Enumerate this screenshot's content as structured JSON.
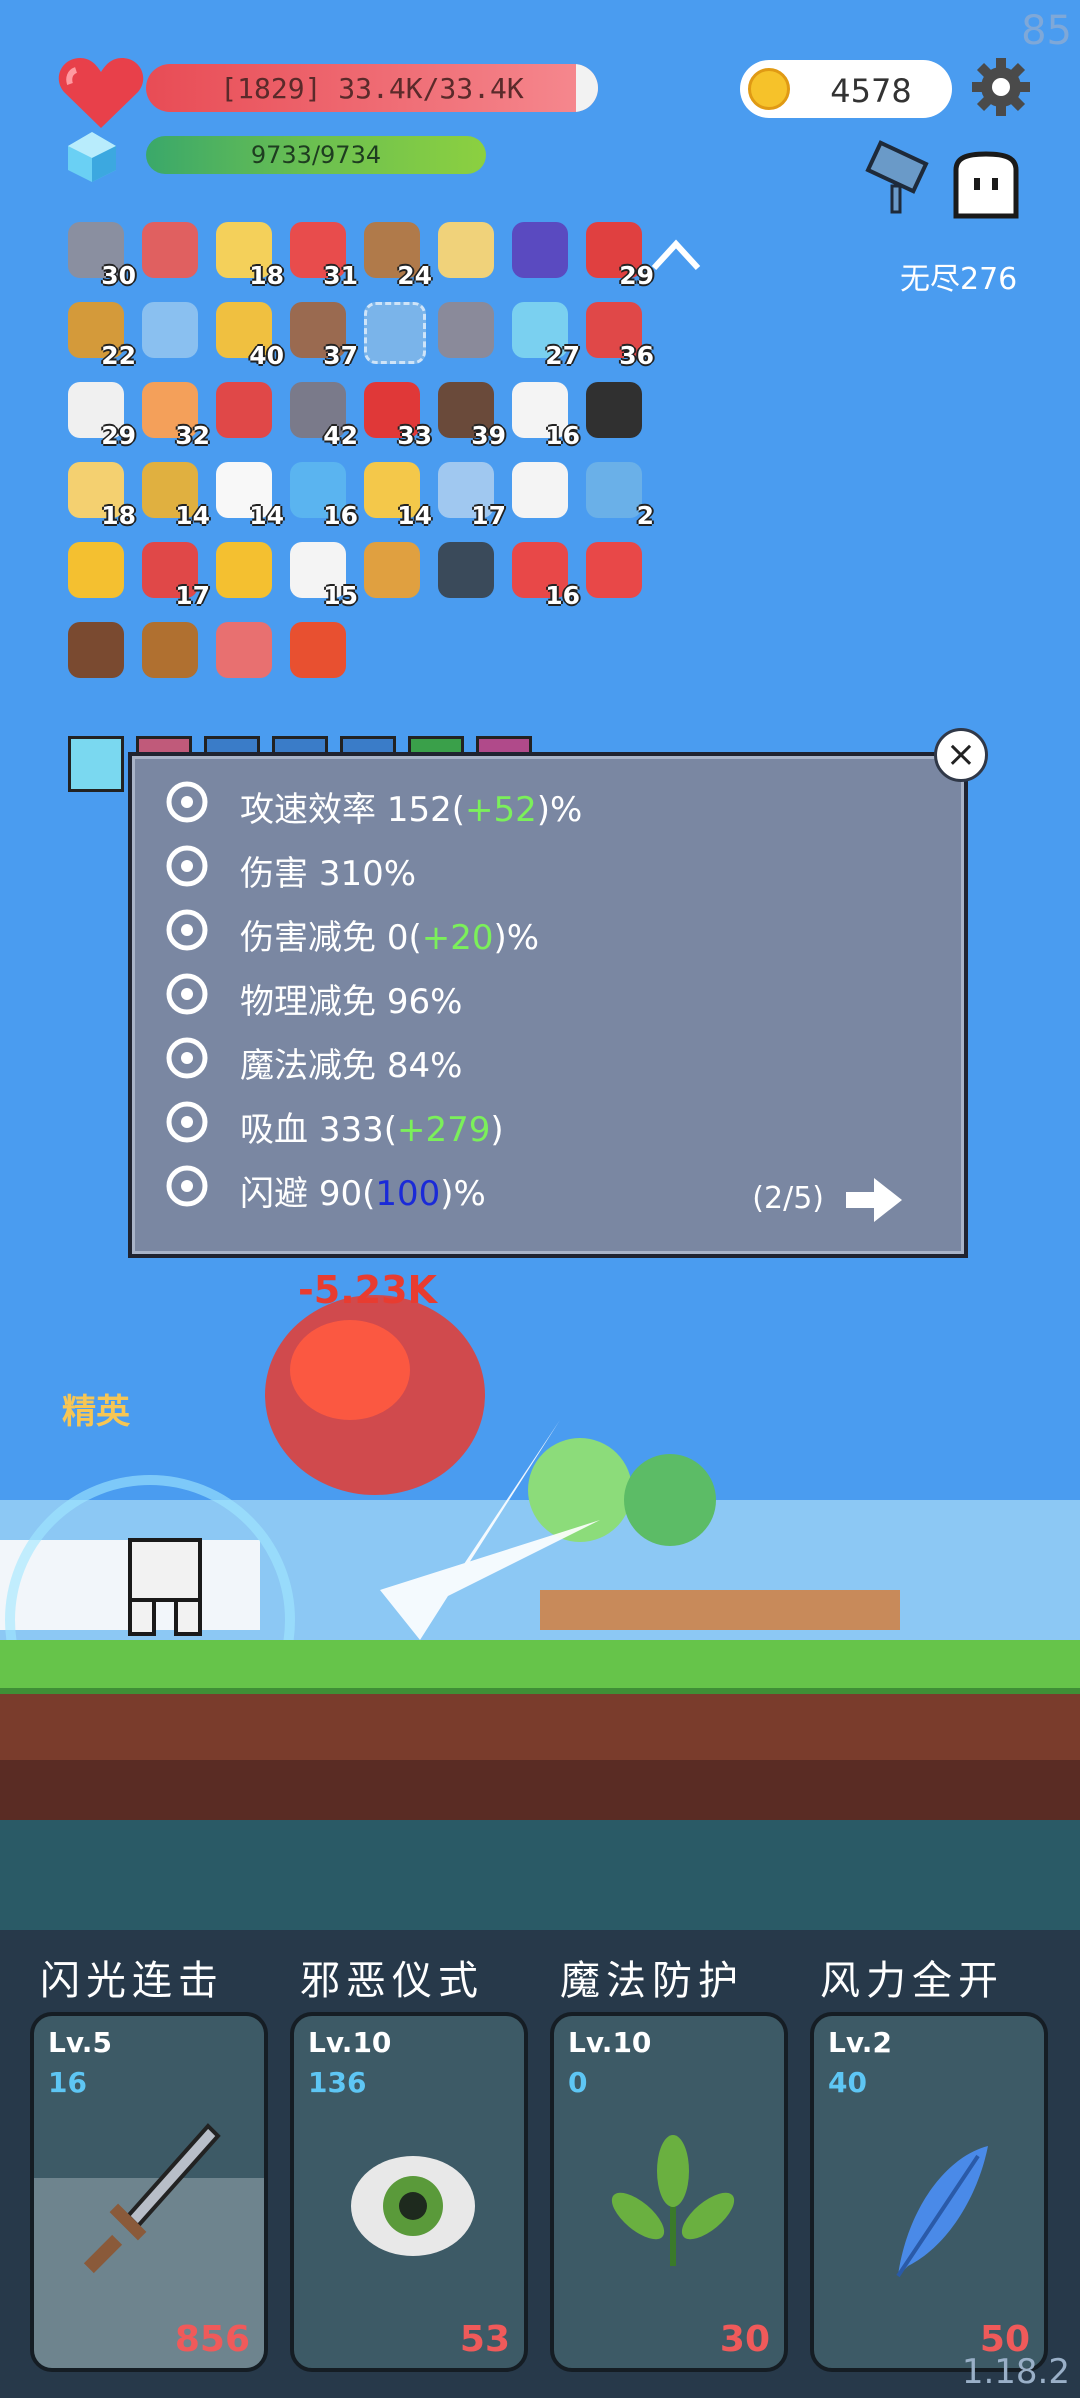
{
  "fps": "85",
  "version": "1.18.2",
  "hud": {
    "hp_text": "[1829] 33.4K/33.4K",
    "hp_fraction": 0.96,
    "mp_text": "9733/9734",
    "gold": "4578",
    "endless_label": "无尽276",
    "colors": {
      "hp": "#e84c55",
      "mp": "#6cc050",
      "gold": "#f6c22a"
    }
  },
  "inventory": {
    "items": [
      {
        "icon": "sword-icon",
        "count": "30",
        "color": "#8a8fa0"
      },
      {
        "icon": "magnet-icon",
        "count": "",
        "color": "#e06060"
      },
      {
        "icon": "flower-icon",
        "count": "18",
        "color": "#f4d05a"
      },
      {
        "icon": "watermelon-icon",
        "count": "31",
        "color": "#e84c4c"
      },
      {
        "icon": "shield-round-icon",
        "count": "24",
        "color": "#b07a4a"
      },
      {
        "icon": "scroll-icon",
        "count": "",
        "color": "#f0d27a"
      },
      {
        "icon": "wizard-hat-icon",
        "count": "",
        "color": "#5a4ac0"
      },
      {
        "icon": "apple-icon",
        "count": "29",
        "color": "#e04040"
      },
      {
        "icon": "book-icon",
        "count": "22",
        "color": "#d49a3a"
      },
      {
        "icon": "shirt-icon",
        "count": "",
        "color": "#8ac0f0"
      },
      {
        "icon": "battery-icon",
        "count": "40",
        "color": "#f0c040"
      },
      {
        "icon": "door-icon",
        "count": "37",
        "color": "#9a6a50"
      },
      {
        "icon": "empty-slot-icon",
        "count": "",
        "color": "#7ab4ea"
      },
      {
        "icon": "spike-ball-icon",
        "count": "",
        "color": "#8a8a9a"
      },
      {
        "icon": "syringe-icon",
        "count": "27",
        "color": "#7ad0f0"
      },
      {
        "icon": "strawberry-icon",
        "count": "36",
        "color": "#e04848"
      },
      {
        "icon": "envelope-icon",
        "count": "29",
        "color": "#f0f0f0"
      },
      {
        "icon": "ice-cream-icon",
        "count": "32",
        "color": "#f4a05a"
      },
      {
        "icon": "gift-icon",
        "count": "",
        "color": "#e04848"
      },
      {
        "icon": "mace-icon",
        "count": "42",
        "color": "#7a7a8a"
      },
      {
        "icon": "red-card-icon",
        "count": "33",
        "color": "#e03838"
      },
      {
        "icon": "coconut-icon",
        "count": "39",
        "color": "#6a4a3a"
      },
      {
        "icon": "playing-card-icon",
        "count": "16",
        "color": "#f4f4f4"
      },
      {
        "icon": "cauldron-icon",
        "count": "",
        "color": "#303030"
      },
      {
        "icon": "note-icon",
        "count": "18",
        "color": "#f4d070"
      },
      {
        "icon": "pineapple-icon",
        "count": "14",
        "color": "#e0b040"
      },
      {
        "icon": "ghost-icon",
        "count": "14",
        "color": "#f8f8f8"
      },
      {
        "icon": "potion-icon",
        "count": "16",
        "color": "#5ab4f0"
      },
      {
        "icon": "cheese-icon",
        "count": "14",
        "color": "#f4c84a"
      },
      {
        "icon": "molecule-icon",
        "count": "17",
        "color": "#a0c8f0"
      },
      {
        "icon": "checklist-icon",
        "count": "",
        "color": "#f4f4f4"
      },
      {
        "icon": "star-card-icon",
        "count": "2",
        "color": "#6ab0e8"
      },
      {
        "icon": "ring-icon",
        "count": "",
        "color": "#f4c030"
      },
      {
        "icon": "sock-icon",
        "count": "17",
        "color": "#e04848"
      },
      {
        "icon": "sun-icon",
        "count": "",
        "color": "#f4c030"
      },
      {
        "icon": "dice-icon",
        "count": "15",
        "color": "#f4f4f4"
      },
      {
        "icon": "crown-icon",
        "count": "",
        "color": "#e0a040"
      },
      {
        "icon": "skull-book-icon",
        "count": "",
        "color": "#3a4a5a"
      },
      {
        "icon": "pill-icon",
        "count": "16",
        "color": "#e84848"
      },
      {
        "icon": "sneaker-icon",
        "count": "",
        "color": "#e84848"
      },
      {
        "icon": "mushroom-icon",
        "count": "",
        "color": "#7a4a30"
      },
      {
        "icon": "drumstick-icon",
        "count": "",
        "color": "#b07030"
      },
      {
        "icon": "hook-icon",
        "count": "",
        "color": "#e87070"
      },
      {
        "icon": "fire-icon",
        "count": "",
        "color": "#e85030"
      }
    ]
  },
  "stats_panel": {
    "rows": [
      {
        "icon": "bullets-icon",
        "label": "攻速效率",
        "value": "152",
        "bonus": "+52",
        "bonus_color": "green",
        "suffix": "%"
      },
      {
        "icon": "crossed-axes-icon",
        "label": "伤害",
        "value": "310%",
        "bonus": "",
        "bonus_color": "",
        "suffix": ""
      },
      {
        "icon": "target-icon",
        "label": "伤害减免",
        "value": "0",
        "bonus": "+20",
        "bonus_color": "green",
        "suffix": "%"
      },
      {
        "icon": "shield-icon",
        "label": "物理减免",
        "value": "96%",
        "bonus": "",
        "bonus_color": "",
        "suffix": ""
      },
      {
        "icon": "heart-shield-icon",
        "label": "魔法减免",
        "value": "84%",
        "bonus": "",
        "bonus_color": "",
        "suffix": ""
      },
      {
        "icon": "horned-skull-icon",
        "label": "吸血",
        "value": "333",
        "bonus": "+279",
        "bonus_color": "green",
        "suffix": ""
      },
      {
        "icon": "dodge-lines-icon",
        "label": "闪避",
        "value": "90",
        "bonus": "100",
        "bonus_color": "blue",
        "suffix": "%"
      }
    ],
    "page_indicator": "(2/5)"
  },
  "battle": {
    "damage_text": "-5.23K",
    "elite_label": "精英"
  },
  "skills": [
    {
      "title": "闪光连击",
      "level": "Lv.5",
      "cost": "16",
      "count": "856",
      "art": "sword-icon"
    },
    {
      "title": "邪恶仪式",
      "level": "Lv.10",
      "cost": "136",
      "count": "53",
      "art": "eye-icon"
    },
    {
      "title": "魔法防护",
      "level": "Lv.10",
      "cost": "0",
      "count": "30",
      "art": "leaf-icon"
    },
    {
      "title": "风力全开",
      "level": "Lv.2",
      "cost": "40",
      "count": "50",
      "art": "feather-icon"
    }
  ]
}
